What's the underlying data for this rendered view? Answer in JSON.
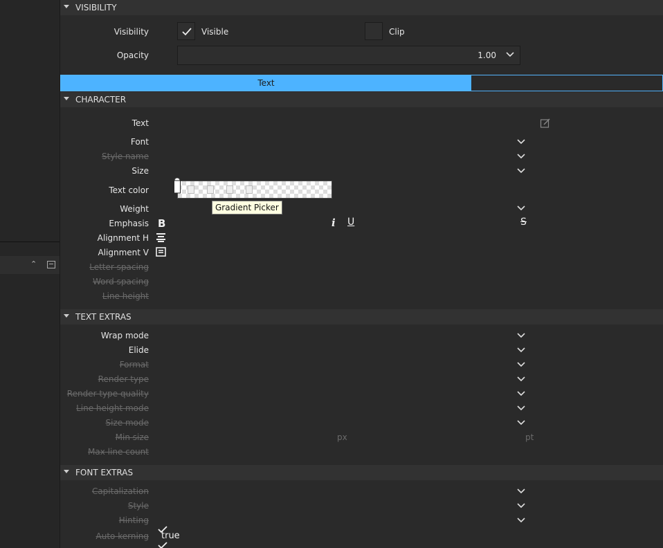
{
  "visibility": {
    "header": "VISIBILITY",
    "visibility_label": "Visibility",
    "visible_label": "Visible",
    "visible_checked": true,
    "clip_label": "Clip",
    "clip_checked": false,
    "opacity_label": "Opacity",
    "opacity_value": "1.00"
  },
  "tabs": {
    "active": "Text"
  },
  "character": {
    "header": "CHARACTER",
    "text_label": "Text",
    "font_label": "Font",
    "style_name_label": "Style name",
    "size_label": "Size",
    "text_color_label": "Text color",
    "tooltip": "Gradient Picker",
    "weight_label": "Weight",
    "emphasis_label": "Emphasis",
    "emphasis_bold": "B",
    "emphasis_italic": "i",
    "emphasis_underline": "U",
    "emphasis_strike": "S",
    "alignment_h_label": "Alignment H",
    "alignment_v_label": "Alignment V",
    "letter_spacing_label": "Letter spacing",
    "word_spacing_label": "Word spacing",
    "line_height_label": "Line height"
  },
  "text_extras": {
    "header": "TEXT EXTRAS",
    "wrap_mode_label": "Wrap mode",
    "elide_label": "Elide",
    "format_label": "Format",
    "render_type_label": "Render type",
    "render_type_quality_label": "Render type quality",
    "line_height_mode_label": "Line height mode",
    "size_mode_label": "Size mode",
    "min_size_label": "Min size",
    "min_size_unit_px": "px",
    "min_size_unit_pt": "pt",
    "max_line_count_label": "Max line count"
  },
  "font_extras": {
    "header": "FONT EXTRAS",
    "capitalization_label": "Capitalization",
    "style_label": "Style",
    "hinting_label": "Hinting",
    "auto_kerning_label": "Auto kerning",
    "auto_kerning_value": "true"
  },
  "icons": {
    "section_toggle": "triangle-down-icon",
    "dropdown": "chevron-down-icon",
    "edit": "edit-icon",
    "align_h": "align-center-icon",
    "align_v": "align-vertical-icon"
  },
  "colors": {
    "accent": "#4db3ff",
    "background": "#2a2a2a",
    "header": "#323232",
    "tooltip_bg": "#ffffe1"
  }
}
